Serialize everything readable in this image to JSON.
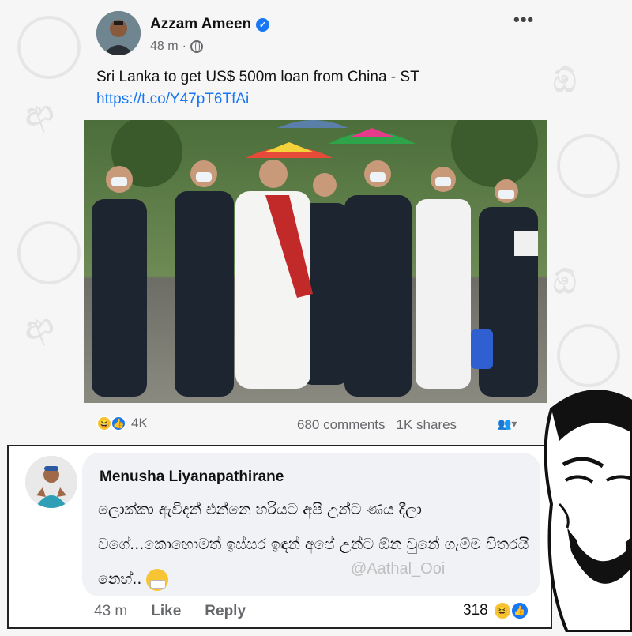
{
  "post": {
    "author": "Azzam Ameen",
    "time": "48 m",
    "separator": "·",
    "more_icon": "more-horizontal-icon",
    "text": "Sri Lanka to get US$ 500m loan from China - ST ",
    "link": "https://t.co/Y47pT6TfAi",
    "reaction_count": "4K",
    "comments": "680 comments",
    "shares": "1K shares"
  },
  "comment": {
    "author": "Menusha Liyanapathirane",
    "text": "ලොක්කා ඇවිදන් එන්නෙ හරියට අපි උන්ට ණය දීලා වගේ...කොහොමත් ඉස්සර ඉඳන් අපේ උන්ට ඕන වුනේ ගැම්ම විතරයි නෙහ්..",
    "watermark": "@Aathal_Ooi",
    "time": "43 m",
    "like_label": "Like",
    "reply_label": "Reply",
    "reaction_count": "318"
  },
  "colors": {
    "link": "#1877f2",
    "secondary_text": "#65676b",
    "bubble": "#f0f2f5"
  }
}
